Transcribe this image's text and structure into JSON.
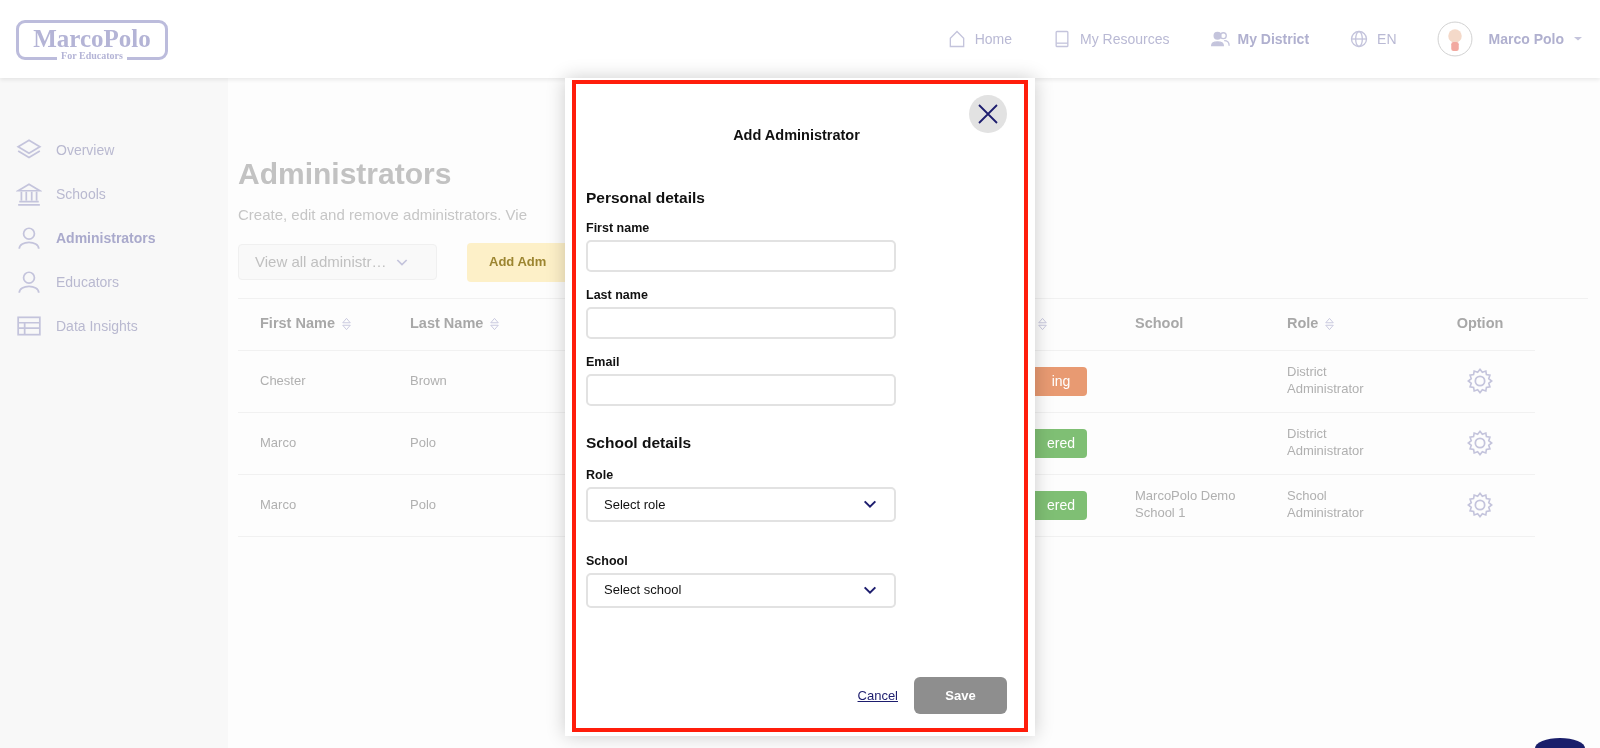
{
  "header": {
    "logo": {
      "title": "MarcoPolo",
      "subtitle": "For Educators"
    },
    "nav": [
      {
        "label": "Home",
        "kind": "home",
        "selected": false
      },
      {
        "label": "My Resources",
        "kind": "book",
        "selected": false
      },
      {
        "label": "My District",
        "kind": "people",
        "selected": true
      }
    ],
    "language": "EN",
    "user": "Marco Polo"
  },
  "sidebar": {
    "items": [
      {
        "label": "Overview",
        "kind": "layers",
        "selected": false
      },
      {
        "label": "Schools",
        "kind": "bank",
        "selected": false
      },
      {
        "label": "Administrators",
        "kind": "person",
        "selected": true
      },
      {
        "label": "Educators",
        "kind": "person",
        "selected": false
      },
      {
        "label": "Data Insights",
        "kind": "table",
        "selected": false
      }
    ]
  },
  "main": {
    "title": "Administrators",
    "description": "Create, edit and remove administrators. Vie",
    "filter": {
      "value": "View all administr…"
    },
    "add_button": "Add Adm",
    "table": {
      "columns": [
        {
          "label": "First Name",
          "sortable": true
        },
        {
          "label": "Last Name",
          "sortable": true
        },
        {
          "sortable": true
        },
        {
          "label": "School",
          "sortable": false
        },
        {
          "label": "Role",
          "sortable": true
        },
        {
          "label": "Option",
          "sortable": false
        }
      ],
      "rows": [
        {
          "first_name": "Chester",
          "last_name": "Brown",
          "status": {
            "label": "ing",
            "color": "#e89a72"
          },
          "school": "",
          "role": "District Administrator"
        },
        {
          "first_name": "Marco",
          "last_name": "Polo",
          "status": {
            "label": "ered",
            "color": "#7fbf74"
          },
          "school": "",
          "role": "District Administrator"
        },
        {
          "first_name": "Marco",
          "last_name": "Polo",
          "status": {
            "label": "ered",
            "color": "#7fbf74"
          },
          "school": "MarcoPolo Demo School 1",
          "role": "School Administrator"
        }
      ]
    }
  },
  "modal": {
    "title": "Add Administrator",
    "sections": [
      {
        "heading": "Personal details",
        "fields": [
          {
            "label": "First name",
            "kind": "text"
          },
          {
            "label": "Last name",
            "kind": "text"
          },
          {
            "label": "Email",
            "kind": "text"
          }
        ]
      },
      {
        "heading": "School details",
        "fields": [
          {
            "label": "Role",
            "kind": "select",
            "placeholder": "Select role"
          },
          {
            "label": "School",
            "kind": "select",
            "placeholder": "Select school"
          }
        ]
      }
    ],
    "cancel": "Cancel",
    "save": "Save"
  }
}
